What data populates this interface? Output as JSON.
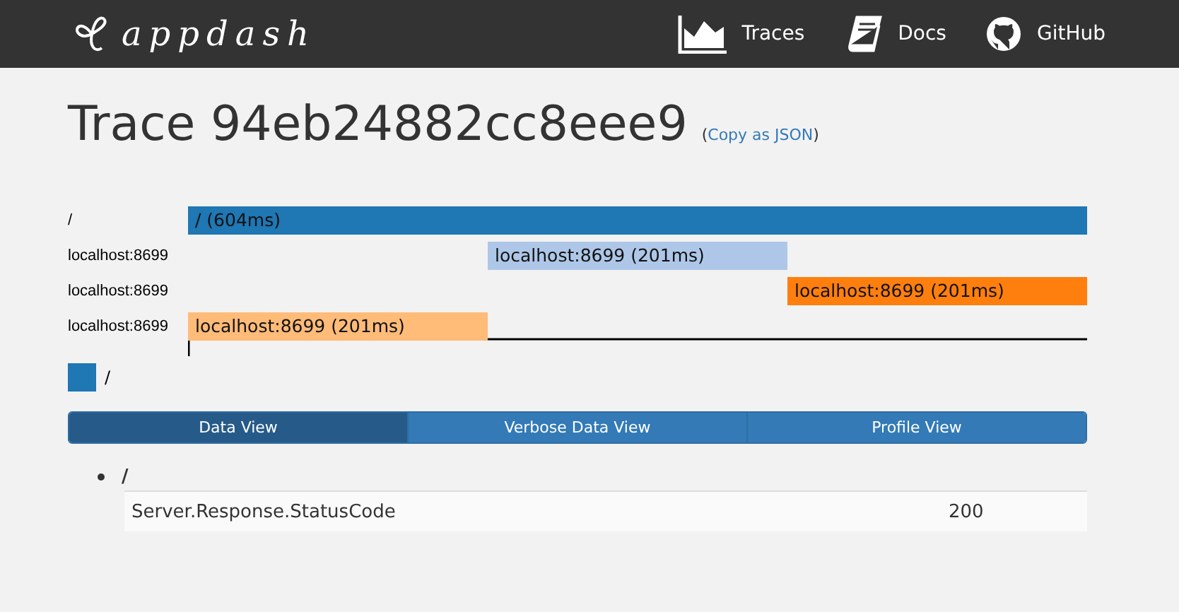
{
  "header": {
    "logo": "appdash",
    "nav": [
      {
        "kind": "chart",
        "label": "Traces"
      },
      {
        "kind": "book",
        "label": "Docs"
      },
      {
        "kind": "github",
        "label": "GitHub"
      }
    ]
  },
  "title": "Trace 94eb24882cc8eee9",
  "copy_link": {
    "open": "(",
    "label": "Copy as JSON",
    "close": ")"
  },
  "timeline": {
    "rows": [
      {
        "label": "/",
        "span": "/ (604ms)",
        "color": "#1f77b4"
      },
      {
        "label": "localhost:8699",
        "span": "localhost:8699 (201ms)",
        "color": "#aec7e8"
      },
      {
        "label": "localhost:8699",
        "span": "localhost:8699 (201ms)",
        "color": "#ff7f0e"
      },
      {
        "label": "localhost:8699",
        "span": "localhost:8699 (201ms)",
        "color": "#ffbb78"
      }
    ],
    "legend": [
      {
        "label": "/",
        "color": "#1f77b4"
      }
    ]
  },
  "tabs": [
    {
      "label": "Data View",
      "selected": true
    },
    {
      "label": "Verbose Data View",
      "selected": false
    },
    {
      "label": "Profile View",
      "selected": false
    }
  ],
  "data": [
    {
      "name": "/",
      "rows": [
        {
          "key": "Server.Response.StatusCode",
          "value": "200"
        }
      ]
    }
  ]
}
